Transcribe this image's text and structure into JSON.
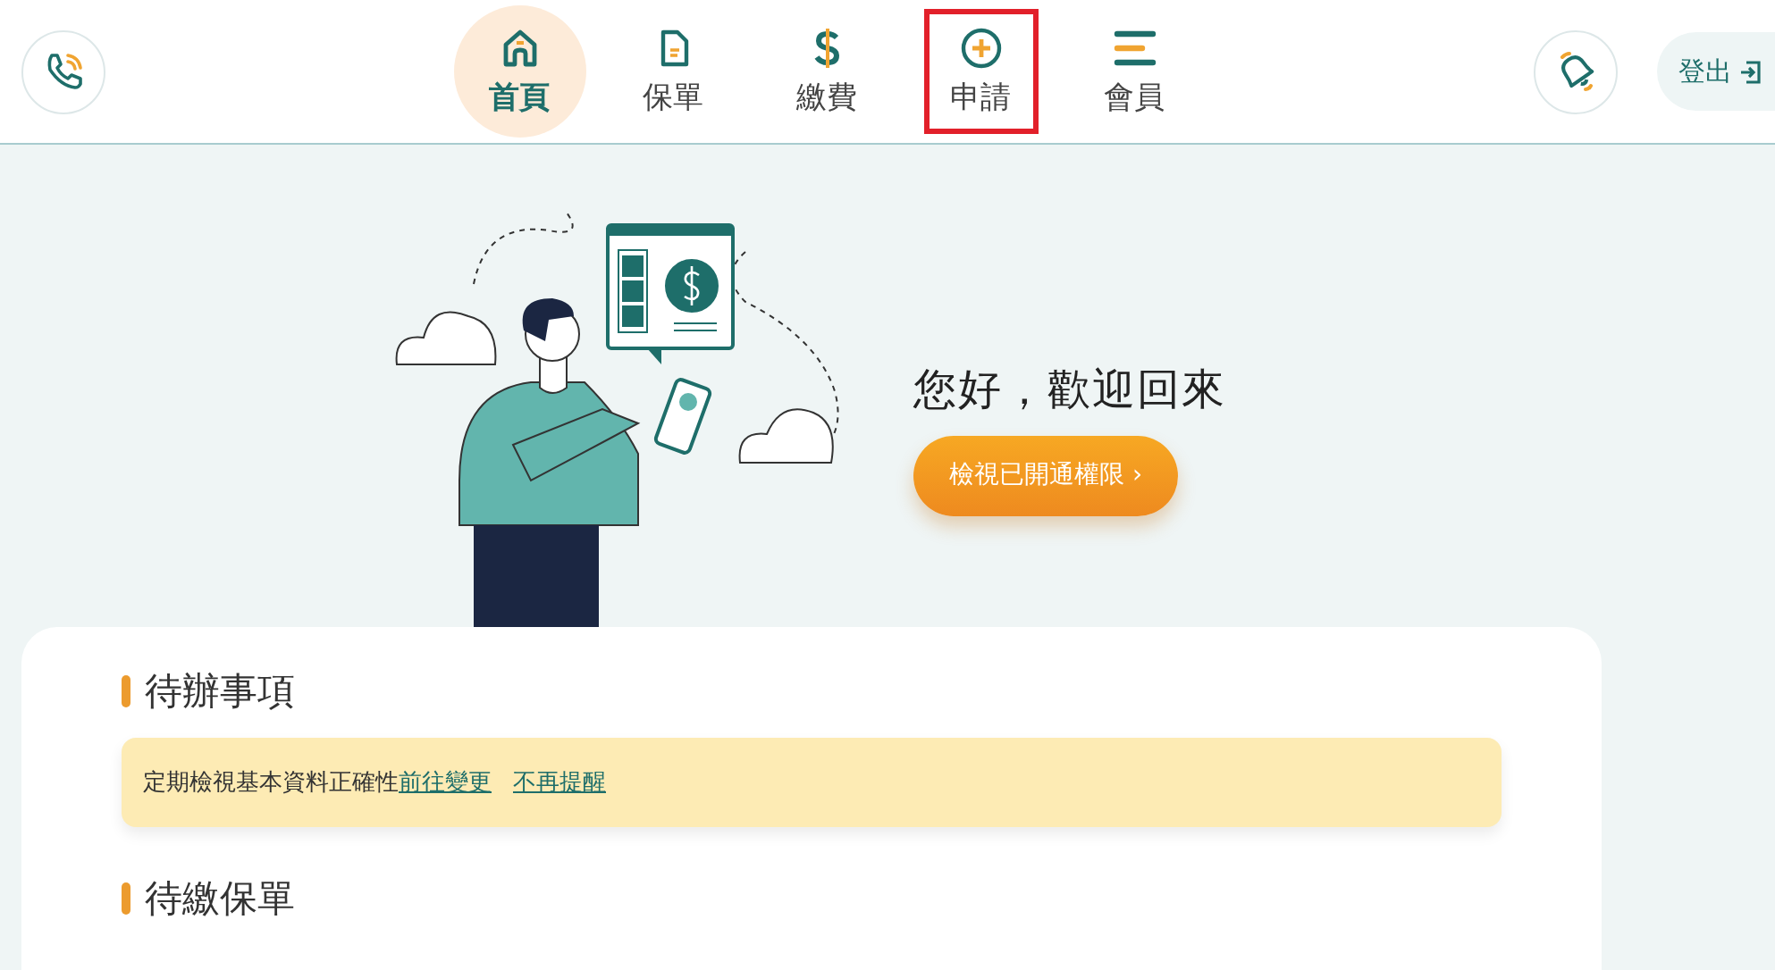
{
  "header": {
    "nav": [
      {
        "label": "首頁",
        "kind": "home",
        "selected": true,
        "highlighted": false
      },
      {
        "label": "保單",
        "kind": "document",
        "selected": false,
        "highlighted": false
      },
      {
        "label": "繳費",
        "kind": "dollar",
        "selected": false,
        "highlighted": false
      },
      {
        "label": "申請",
        "kind": "plus",
        "selected": false,
        "highlighted": true
      },
      {
        "label": "會員",
        "kind": "bars",
        "selected": false,
        "highlighted": false
      }
    ],
    "logout": "登出"
  },
  "hero": {
    "greeting": "您好，歡迎回來",
    "button": "檢視已開通權限 ›"
  },
  "sections": [
    {
      "title": "待辦事項",
      "notices": [
        {
          "text": "定期檢視基本資料正確性",
          "links": [
            "前往變更",
            "不再提醒"
          ]
        }
      ]
    },
    {
      "title": "待繳保單"
    }
  ]
}
